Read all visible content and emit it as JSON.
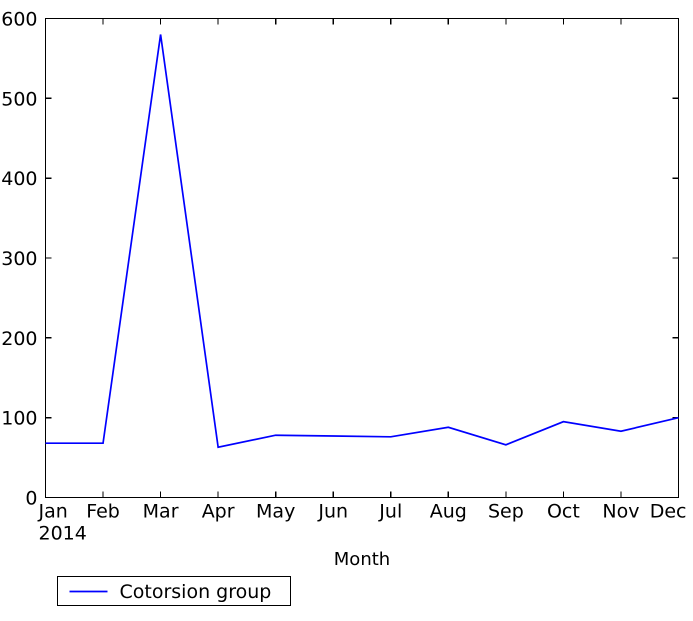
{
  "chart_data": {
    "type": "line",
    "title": "",
    "xlabel": "Month",
    "ylabel": "",
    "x_unit_label": "2014",
    "categories": [
      "Jan",
      "Feb",
      "Mar",
      "Apr",
      "May",
      "Jun",
      "Jul",
      "Aug",
      "Sep",
      "Oct",
      "Nov",
      "Dec"
    ],
    "series": [
      {
        "name": "Cotorsion group",
        "color": "#0000ff",
        "values": [
          68,
          68,
          580,
          63,
          78,
          77,
          76,
          88,
          66,
          95,
          83,
          100
        ]
      }
    ],
    "ylim": [
      0,
      600
    ],
    "y_ticks": [
      0,
      100,
      200,
      300,
      400,
      500,
      600
    ],
    "y_tick_labels": [
      "0",
      "100",
      "200",
      "300",
      "400",
      "500",
      "600"
    ],
    "grid": false,
    "legend_position": "below-left"
  },
  "legend": {
    "entries": [
      {
        "label": "Cotorsion group",
        "color": "#0000ff"
      }
    ]
  },
  "axes": {
    "x_axis_title": "Month",
    "x_unit": "2014"
  }
}
